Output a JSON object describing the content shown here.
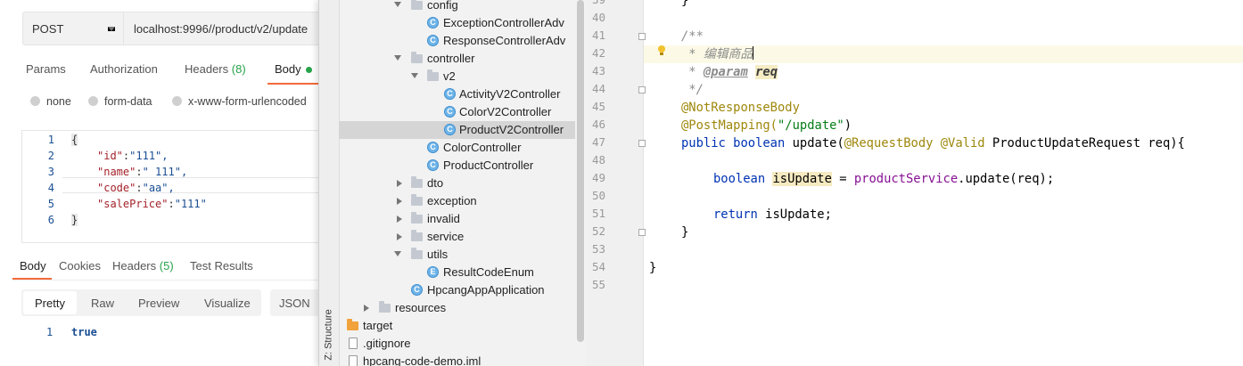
{
  "postman": {
    "method": "POST",
    "url": "localhost:9996//product/v2/update",
    "request_tabs": {
      "params": "Params",
      "authorization": "Authorization",
      "headers": "Headers",
      "headers_count": "(8)",
      "body": "Body"
    },
    "body_modes": [
      "none",
      "form-data",
      "x-www-form-urlencoded"
    ],
    "body_lines": [
      {
        "n": "1",
        "text": "{"
      },
      {
        "n": "2",
        "key": "\"id\"",
        "value": "\"111\","
      },
      {
        "n": "3",
        "key": "\"name\"",
        "value": "\" 111\","
      },
      {
        "n": "4",
        "key": "\"code\"",
        "value": "\"aa\","
      },
      {
        "n": "5",
        "key": "\"salePrice\"",
        "value": "\"111\""
      },
      {
        "n": "6",
        "text": "}"
      }
    ],
    "response_tabs": {
      "body": "Body",
      "cookies": "Cookies",
      "headers": "Headers",
      "headers_count": "(5)",
      "test_results": "Test Results"
    },
    "view_modes": [
      "Pretty",
      "Raw",
      "Preview",
      "Visualize"
    ],
    "format": "JSON",
    "response_line_no": "1",
    "response_value": "true"
  },
  "project_tree": {
    "structure_label": "Z: Structure",
    "items": [
      {
        "label": "config",
        "type": "folder",
        "expanded": true
      },
      {
        "label": "ExceptionControllerAdv",
        "type": "class"
      },
      {
        "label": "ResponseControllerAdv",
        "type": "class"
      },
      {
        "label": "controller",
        "type": "folder",
        "expanded": true
      },
      {
        "label": "v2",
        "type": "folder",
        "expanded": true
      },
      {
        "label": "ActivityV2Controller",
        "type": "class"
      },
      {
        "label": "ColorV2Controller",
        "type": "class"
      },
      {
        "label": "ProductV2Controller",
        "type": "class",
        "selected": true
      },
      {
        "label": "ColorController",
        "type": "class"
      },
      {
        "label": "ProductController",
        "type": "class"
      },
      {
        "label": "dto",
        "type": "folder",
        "expanded": false
      },
      {
        "label": "exception",
        "type": "folder",
        "expanded": false
      },
      {
        "label": "invalid",
        "type": "folder",
        "expanded": false
      },
      {
        "label": "service",
        "type": "folder",
        "expanded": false
      },
      {
        "label": "utils",
        "type": "folder",
        "expanded": true
      },
      {
        "label": "ResultCodeEnum",
        "type": "enum"
      },
      {
        "label": "HpcangAppApplication",
        "type": "app-class"
      },
      {
        "label": "resources",
        "type": "folder",
        "expanded": false
      },
      {
        "label": "target",
        "type": "folder-orange"
      },
      {
        "label": ".gitignore",
        "type": "file"
      },
      {
        "label": "hpcang-code-demo.iml",
        "type": "file"
      }
    ]
  },
  "editor": {
    "line_numbers": [
      "39",
      "40",
      "41",
      "42",
      "43",
      "44",
      "45",
      "46",
      "47",
      "48",
      "49",
      "50",
      "51",
      "52",
      "53",
      "54",
      "55"
    ],
    "lines": {
      "l39": "}",
      "l41": "/**",
      "l42_text": " * 编辑商品",
      "l43_star": " * ",
      "l43_tag": "@param",
      "l43_name": "req",
      "l44": " */",
      "l45": "@NotResponseBody",
      "l46_anno": "@PostMapping(",
      "l46_str": "\"/update\"",
      "l46_end": ")",
      "l47_kw": "public boolean",
      "l47_m": " update(",
      "l47_a1": "@RequestBody",
      "l47_a2": "@Valid",
      "l47_rest": " ProductUpdateRequest req){",
      "l49_kw": "boolean",
      "l49_var": "isUpdate",
      "l49_eq": " = ",
      "l49_fld": "productService",
      "l49_rest": ".update(req);",
      "l51_kw": "return",
      "l51_rest": " isUpdate;",
      "l52": "}",
      "l54": "}"
    }
  }
}
